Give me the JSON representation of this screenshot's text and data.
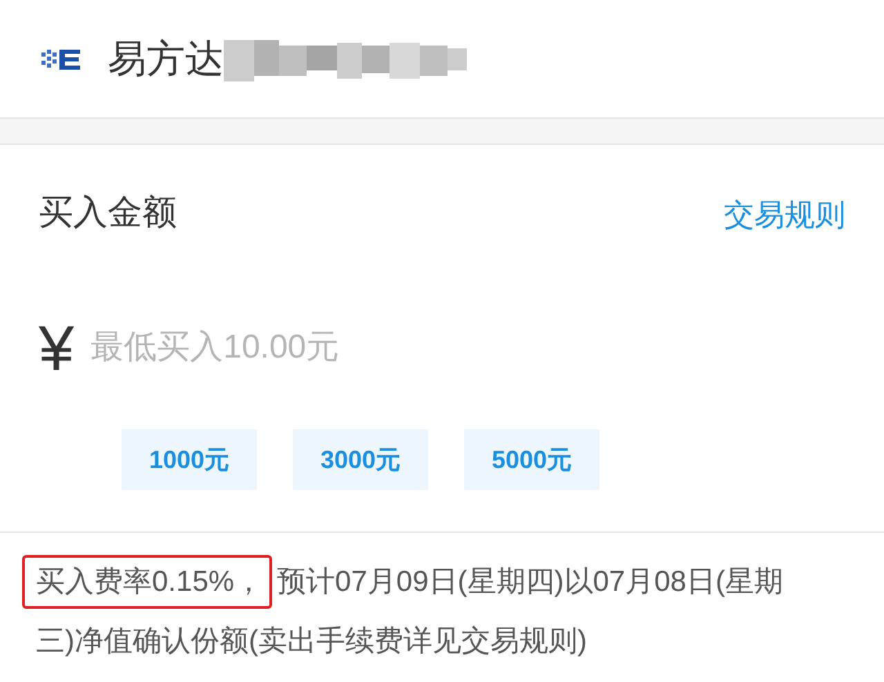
{
  "header": {
    "title": "易方达"
  },
  "section": {
    "title": "买入金额",
    "link": "交易规则"
  },
  "amount_field": {
    "currency": "¥",
    "placeholder": "最低买入10.00元"
  },
  "quick_amounts": [
    "1000元",
    "3000元",
    "5000元"
  ],
  "notice": {
    "highlighted": "买入费率0.15%，",
    "text": "预计07月09日(星期四)以07月08日(星期三)净值确认份额(卖出手续费详见交易规则)"
  }
}
